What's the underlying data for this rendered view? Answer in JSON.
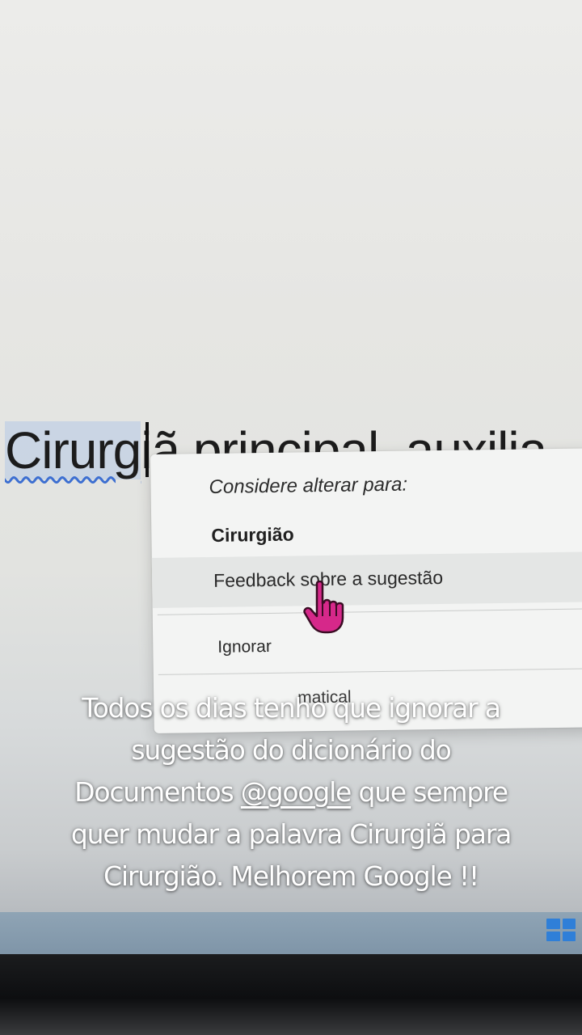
{
  "document": {
    "line_misspelled": "Cirurg",
    "line_rest": "iã principal, auxilia"
  },
  "context_menu": {
    "title": "Considere alterar para:",
    "suggestion": "Cirurgião",
    "feedback": "Feedback sobre a sugestão",
    "ignore": "Ignorar",
    "grammar_partial": "matical"
  },
  "caption": {
    "line1": "Todos os dias tenho que ignorar a",
    "line2": "sugestão do dicionário do",
    "line3_before": "Documentos ",
    "mention": "@google",
    "line3_after": " que sempre",
    "line4": "quer mudar a palavra Cirurgiã para",
    "line5": "Cirurgião. Melhorem Google !!"
  },
  "icons": {
    "pointer": "hand-pointer-icon",
    "taskbar_start": "windows-icon"
  },
  "colors": {
    "pointer": "#d6288a",
    "spell_underline": "#3d6fd1",
    "windows_blue": "#2f7fd8"
  }
}
